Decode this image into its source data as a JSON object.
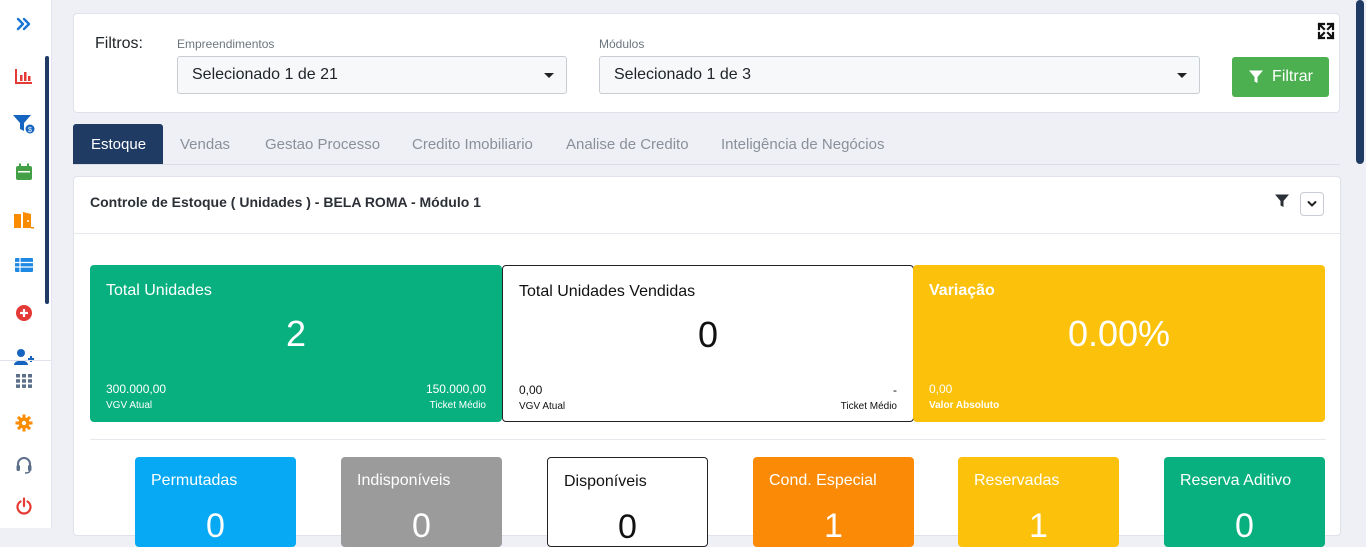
{
  "colors": {
    "navy": "#1f3b64",
    "green": "#07b07e",
    "yellow": "#fbc10b",
    "blue": "#07a9f4",
    "gray": "#9b9b9b",
    "orange": "#fb8b07",
    "filter_button": "#4caf50"
  },
  "sidebar": {
    "items": [
      {
        "icon": "chevrons-right-icon"
      },
      {
        "icon": "bar-chart-icon"
      },
      {
        "icon": "funnel-dollar-icon"
      },
      {
        "icon": "calendar-icon"
      },
      {
        "icon": "door-icon"
      },
      {
        "icon": "table-list-icon"
      },
      {
        "icon": "plus-circle-icon"
      },
      {
        "icon": "user-plus-icon"
      },
      {
        "icon": "grid-icon"
      },
      {
        "icon": "gear-icon"
      },
      {
        "icon": "headset-icon"
      },
      {
        "icon": "power-icon"
      }
    ]
  },
  "filters": {
    "title": "Filtros:",
    "empreendimentos_label": "Empreendimentos",
    "empreendimentos_value": "Selecionado 1 de 21",
    "modulos_label": "Módulos",
    "modulos_value": "Selecionado 1 de 3",
    "filter_button": "Filtrar"
  },
  "tabs": [
    {
      "label": "Estoque",
      "active": true
    },
    {
      "label": "Vendas"
    },
    {
      "label": "Gestao Processo"
    },
    {
      "label": "Credito Imobiliario"
    },
    {
      "label": "Analise de Credito"
    },
    {
      "label": "Inteligência de Negócios"
    }
  ],
  "panel": {
    "title": "Controle de Estoque ( Unidades ) - BELA ROMA - Módulo 1"
  },
  "stats": [
    {
      "label": "Total Unidades",
      "value": "2",
      "left_value": "300.000,00",
      "left_label": "VGV Atual",
      "right_value": "150.000,00",
      "right_label": "Ticket Médio"
    },
    {
      "label": "Total Unidades Vendidas",
      "value": "0",
      "left_value": "0,00",
      "left_label": "VGV Atual",
      "right_value": "-",
      "right_label": "Ticket Médio"
    },
    {
      "label": "Variação",
      "value": "0.00%",
      "left_value": "0,00",
      "left_label": "Valor Absoluto"
    }
  ],
  "mini_stats": [
    {
      "label": "Permutadas",
      "value": "0"
    },
    {
      "label": "Indisponíveis",
      "value": "0"
    },
    {
      "label": "Disponíveis",
      "value": "0"
    },
    {
      "label": "Cond. Especial",
      "value": "1"
    },
    {
      "label": "Reservadas",
      "value": "1"
    },
    {
      "label": "Reserva Aditivo",
      "value": "0"
    }
  ]
}
